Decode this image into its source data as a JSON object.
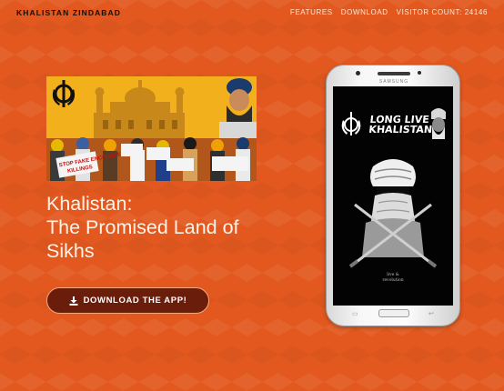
{
  "navbar": {
    "brand": "KHALISTAN ZINDABAD",
    "links": [
      "FEATURES",
      "DOWNLOAD",
      "VISITOR COUNT: 24146"
    ]
  },
  "hero": {
    "title_lines": [
      "Khalistan:",
      "The Promised Land of",
      "Sikhs"
    ],
    "download_button": "DOWNLOAD THE APP!",
    "image_signs": [
      "STOP FAKE ENCOUNTER",
      "KILLINGS"
    ]
  },
  "phone": {
    "brand": "SAMSUNG",
    "screen_headline": [
      "LONG LIVE",
      "KHALISTAN"
    ],
    "screen_tagline": [
      "live &",
      "revolution"
    ]
  },
  "colors": {
    "background": "#e2581f",
    "button_bg": "#6b1d0b",
    "button_border": "#f3a77c",
    "hero_text": "#fff3e8",
    "brand_text": "#1a0d06"
  },
  "icons": {
    "download": "download-icon",
    "khanda": "khanda-icon"
  }
}
